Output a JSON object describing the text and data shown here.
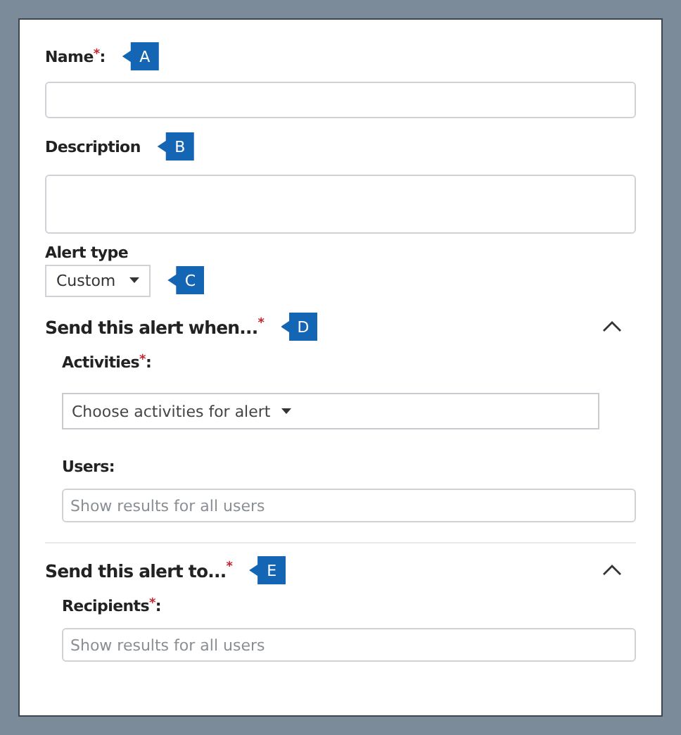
{
  "fields": [
    {
      "kind": "text",
      "label": "Name",
      "required_mark": "*",
      "suffix": ":",
      "callout": "A"
    },
    {
      "kind": "multiline",
      "label": "Description",
      "callout": "B"
    },
    {
      "kind": "select",
      "label": "Alert type",
      "value": "Custom",
      "callout": "C"
    }
  ],
  "sections": [
    {
      "title": "Send this alert when...",
      "required_mark": "*",
      "callout": "D",
      "expanded": true,
      "fields": [
        {
          "kind": "dropdown",
          "label": "Activities",
          "required_mark": "*",
          "suffix": ":",
          "placeholder": "Choose activities for alert"
        },
        {
          "kind": "text",
          "label": "Users:",
          "placeholder": "Show results for all users"
        }
      ]
    },
    {
      "title": "Send this alert to...",
      "required_mark": "*",
      "callout": "E",
      "expanded": true,
      "fields": [
        {
          "kind": "text",
          "label": "Recipients",
          "required_mark": "*",
          "suffix": ":",
          "placeholder": "Show results for all users"
        }
      ]
    }
  ]
}
